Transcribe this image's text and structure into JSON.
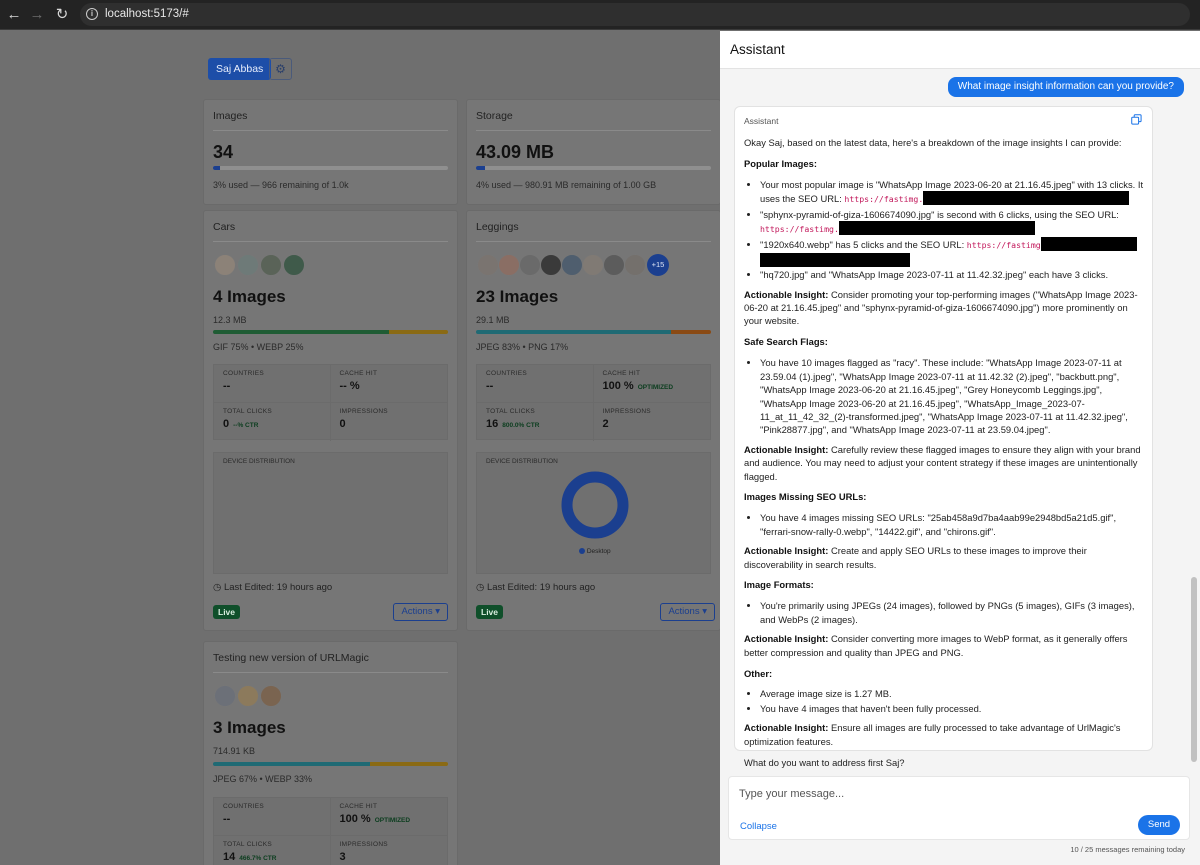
{
  "browser": {
    "url": "localhost:5173/#",
    "back_icon": "←",
    "forward_icon": "→",
    "reload_icon": "↻",
    "info_icon": "i"
  },
  "dashboard": {
    "user_name": "Saj Abbas",
    "settings_icon": "⚙",
    "cards": [
      {
        "title": "Images",
        "value": "34",
        "usage_percent": 3,
        "note": "3% used — 966 remaining of 1.0k"
      },
      {
        "title": "Storage",
        "value": "43.09 MB",
        "usage_percent": 4,
        "note": "4% used — 980.91 MB remaining of 1.00 GB"
      }
    ],
    "groups": [
      {
        "title": "Cars",
        "count_label": "4 Images",
        "size": "12.3 MB",
        "formats": "GIF 75% • WEBP 25%",
        "format_split": [
          75,
          25
        ],
        "stats": {
          "countries_label": "COUNTRIES",
          "countries": "--",
          "cache_label": "CACHE HIT",
          "cache": "-- %",
          "cache_tag": "",
          "clicks_label": "TOTAL CLICKS",
          "clicks": "0",
          "ctr": "--% CTR",
          "impressions_label": "IMPRESSIONS",
          "impressions": "0"
        },
        "device_label": "DEVICE DISTRIBUTION",
        "last_edited": "Last Edited: 19 hours ago",
        "status": "Live",
        "actions_label": "Actions ▾"
      },
      {
        "title": "Leggings",
        "count_label": "23 Images",
        "size": "29.1 MB",
        "formats": "JPEG 83% • PNG 17%",
        "format_split": [
          83,
          17
        ],
        "more_avatars": "+15",
        "stats": {
          "countries_label": "COUNTRIES",
          "countries": "--",
          "cache_label": "CACHE HIT",
          "cache": "100 %",
          "cache_tag": "OPTIMIZED",
          "clicks_label": "TOTAL CLICKS",
          "clicks": "16",
          "ctr": "800.0% CTR",
          "impressions_label": "IMPRESSIONS",
          "impressions": "2"
        },
        "device_label": "DEVICE DISTRIBUTION",
        "device_legend": "Desktop",
        "device_share": [
          100
        ],
        "last_edited": "Last Edited: 19 hours ago",
        "status": "Live",
        "actions_label": "Actions ▾"
      },
      {
        "title": "Testing new version of URLMagic",
        "count_label": "3 Images",
        "size": "714.91 KB",
        "formats": "JPEG 67% • WEBP 33%",
        "format_split": [
          67,
          33
        ],
        "stats": {
          "countries_label": "COUNTRIES",
          "countries": "--",
          "cache_label": "CACHE HIT",
          "cache": "100 %",
          "cache_tag": "OPTIMIZED",
          "clicks_label": "TOTAL CLICKS",
          "clicks": "14",
          "ctr": "466.7% CTR",
          "impressions_label": "IMPRESSIONS",
          "impressions": "3"
        }
      }
    ]
  },
  "assistant": {
    "title": "Assistant",
    "user_message": "What image insight information can you provide?",
    "reply_author": "Assistant",
    "reply": {
      "intro": "Okay Saj, based on the latest data, here's a breakdown of the image insights I can provide:",
      "popular_heading": "Popular Images:",
      "popular_1a": "Your most popular image is \"WhatsApp Image 2023-06-20 at 21.16.45.jpeg\" with 13 clicks. It uses the SEO URL:",
      "popular_1_url": "https://fastimg.",
      "popular_2a": "\"sphynx-pyramid-of-giza-1606674090.jpg\" is second with 6 clicks, using the SEO URL:",
      "popular_2_url": "https://fastimg.",
      "popular_3a": "\"1920x640.webp\" has 5 clicks and the SEO URL:",
      "popular_3_url": "https://fastimg",
      "popular_4": "\"hq720.jpg\" and \"WhatsApp Image 2023-07-11 at 11.42.32.jpeg\" each have 3 clicks.",
      "insight_label": "Actionable Insight:",
      "popular_insight": "Consider promoting your top-performing images (\"WhatsApp Image 2023-06-20 at 21.16.45.jpeg\" and \"sphynx-pyramid-of-giza-1606674090.jpg\") more prominently on your website.",
      "safe_heading": "Safe Search Flags:",
      "safe_1": "You have 10 images flagged as \"racy\". These include: \"WhatsApp Image 2023-07-11 at 23.59.04 (1).jpeg\", \"WhatsApp Image 2023-07-11 at 11.42.32 (2).jpeg\", \"backbutt.png\", \"WhatsApp Image 2023-06-20 at 21.16.45.jpeg\", \"Grey Honeycomb Leggings.jpg\", \"WhatsApp Image 2023-06-20 at 21.16.45.jpeg\", \"WhatsApp_Image_2023-07-11_at_11_42_32_(2)-transformed.jpeg\", \"WhatsApp Image 2023-07-11 at 11.42.32.jpeg\", \"Pink28877.jpg\", and \"WhatsApp Image 2023-07-11 at 23.59.04.jpeg\".",
      "safe_insight": "Carefully review these flagged images to ensure they align with your brand and audience. You may need to adjust your content strategy if these images are unintentionally flagged.",
      "seo_heading": "Images Missing SEO URLs:",
      "seo_1": "You have 4 images missing SEO URLs: \"25ab458a9d7ba4aab99e2948bd5a21d5.gif\", \"ferrari-snow-rally-0.webp\", \"14422.gif\", and \"chirons.gif\".",
      "seo_insight": "Create and apply SEO URLs to these images to improve their discoverability in search results.",
      "formats_heading": "Image Formats:",
      "formats_1": "You're primarily using JPEGs (24 images), followed by PNGs (5 images), GIFs (3 images), and WebPs (2 images).",
      "formats_insight": "Consider converting more images to WebP format, as it generally offers better compression and quality than JPEG and PNG.",
      "other_heading": "Other:",
      "other_1": "Average image size is 1.27 MB.",
      "other_2": "You have 4 images that haven't been fully processed.",
      "other_insight": "Ensure all images are fully processed to take advantage of UrlMagic's optimization features.",
      "closing": "What do you want to address first Saj?"
    },
    "input_placeholder": "Type your message...",
    "collapse_label": "Collapse",
    "send_label": "Send",
    "remaining": "10 / 25 messages remaining today"
  }
}
